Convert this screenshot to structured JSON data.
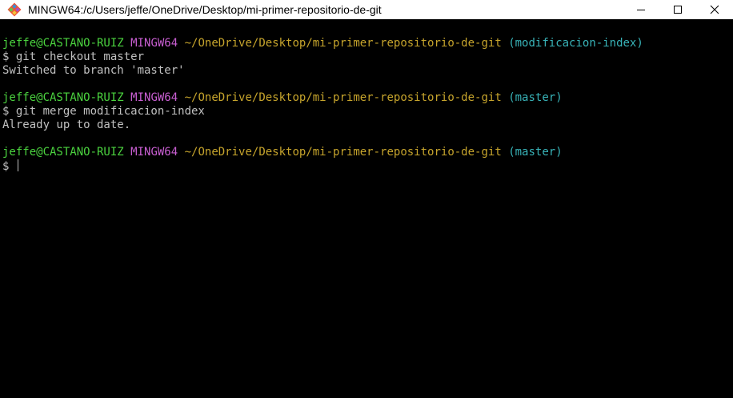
{
  "window": {
    "title": "MINGW64:/c/Users/jeffe/OneDrive/Desktop/mi-primer-repositorio-de-git",
    "icon": "git-logo-icon",
    "controls": [
      "minimize-icon",
      "maximize-icon",
      "close-icon"
    ]
  },
  "colors": {
    "user": "#4bd33f",
    "system": "#c95fd2",
    "path": "#c6a42c",
    "branch": "#38b3b8",
    "text": "#c0c0c0",
    "background": "#000000"
  },
  "terminal": {
    "blocks": [
      {
        "prompt": {
          "user": "jeffe@CASTANO-RUIZ",
          "system": "MINGW64",
          "path": "~/OneDrive/Desktop/mi-primer-repositorio-de-git",
          "branch": "(modificacion-index)"
        },
        "command": "$ git checkout master",
        "output": "Switched to branch 'master'"
      },
      {
        "prompt": {
          "user": "jeffe@CASTANO-RUIZ",
          "system": "MINGW64",
          "path": "~/OneDrive/Desktop/mi-primer-repositorio-de-git",
          "branch": "(master)"
        },
        "command": "$ git merge modificacion-index",
        "output": "Already up to date."
      },
      {
        "prompt": {
          "user": "jeffe@CASTANO-RUIZ",
          "system": "MINGW64",
          "path": "~/OneDrive/Desktop/mi-primer-repositorio-de-git",
          "branch": "(master)"
        },
        "command": "$ "
      }
    ]
  }
}
